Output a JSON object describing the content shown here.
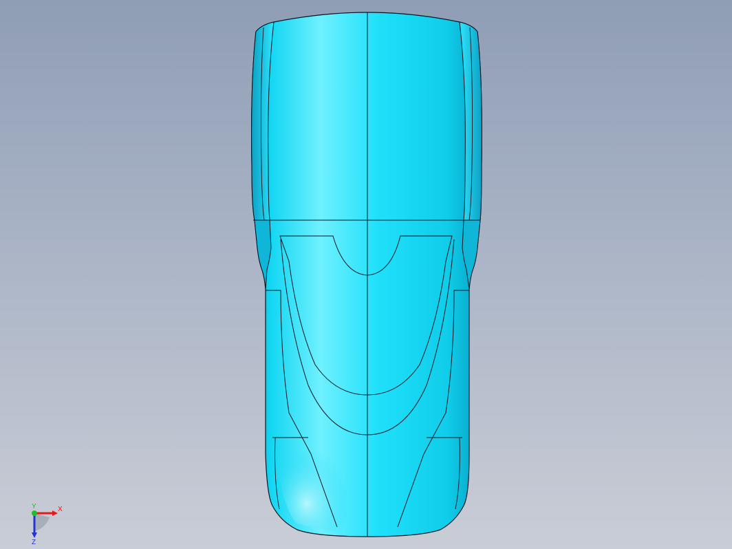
{
  "viewport": {
    "background_top": "#8f9db5",
    "background_bottom": "#c9cdd6"
  },
  "model": {
    "body_color": "#12d6f2",
    "highlight_color": "#7ff4ff",
    "edge_color": "#0a1420"
  },
  "triad": {
    "x_label": "X",
    "y_label": "Y",
    "z_label": "Z",
    "x_color": "#e81818",
    "y_color": "#1fbf2a",
    "z_color": "#2334d6"
  }
}
